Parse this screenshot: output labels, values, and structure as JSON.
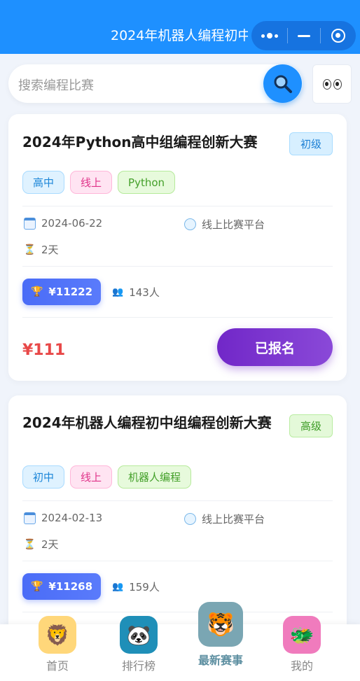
{
  "topbar": {
    "title": "2024年机器人编程初中..."
  },
  "search": {
    "placeholder": "搜索编程比赛"
  },
  "cards": [
    {
      "title": "2024年Python高中组编程创新大赛",
      "level": "初级",
      "tags": [
        "高中",
        "线上",
        "Python"
      ],
      "date": "2024-06-22",
      "location": "线上比赛平台",
      "duration": "2天",
      "prize": "¥11222",
      "participants": "143人",
      "price": "¥111",
      "button": "已报名"
    },
    {
      "title": "2024年机器人编程初中组编程创新大赛",
      "level": "高级",
      "tags": [
        "初中",
        "线上",
        "机器人编程"
      ],
      "date": "2024-02-13",
      "location": "线上比赛平台",
      "duration": "2天",
      "prize": "¥11268",
      "participants": "159人"
    }
  ],
  "tabbar": {
    "items": [
      {
        "label": "首页",
        "icon": "lion-icon"
      },
      {
        "label": "排行榜",
        "icon": "panda-icon"
      },
      {
        "label": "最新赛事",
        "icon": "tiger-icon"
      },
      {
        "label": "我的",
        "icon": "dragon-icon"
      }
    ]
  }
}
